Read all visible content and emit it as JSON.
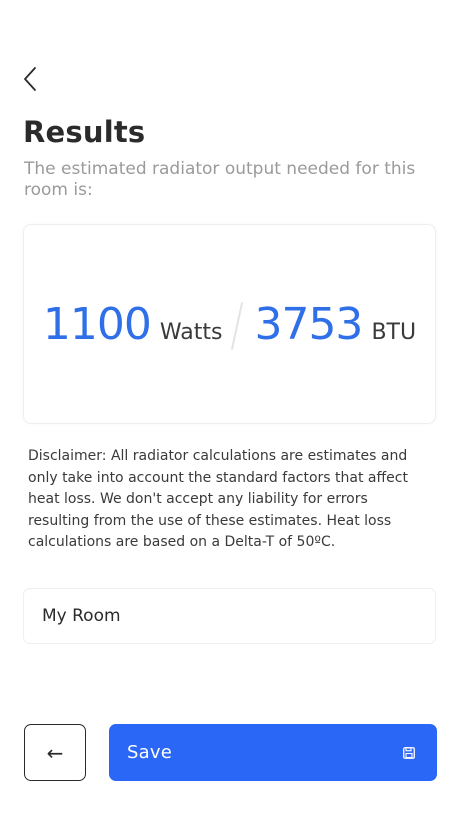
{
  "header": {
    "back_icon": "chevron-left-icon",
    "title": "Results",
    "subtitle": "The estimated radiator output needed for this room is:"
  },
  "result": {
    "watts_value": "1100",
    "watts_unit": "Watts",
    "btu_value": "3753",
    "btu_unit": "BTU"
  },
  "disclaimer": "Disclaimer: All radiator calculations are estimates and only take into account the standard factors that affect heat loss. We don't accept any liability for errors resulting from the use of these estimates. Heat loss calculations are based on a Delta-T of 50ºC.",
  "room_name": {
    "value": "My Room",
    "placeholder": ""
  },
  "footer": {
    "back_arrow": "←",
    "save_label": "Save",
    "save_icon": "floppy-disk-icon"
  },
  "colors": {
    "accent": "#2b67f6",
    "number": "#2f6fe8",
    "subtitle": "#9a9a9a"
  }
}
